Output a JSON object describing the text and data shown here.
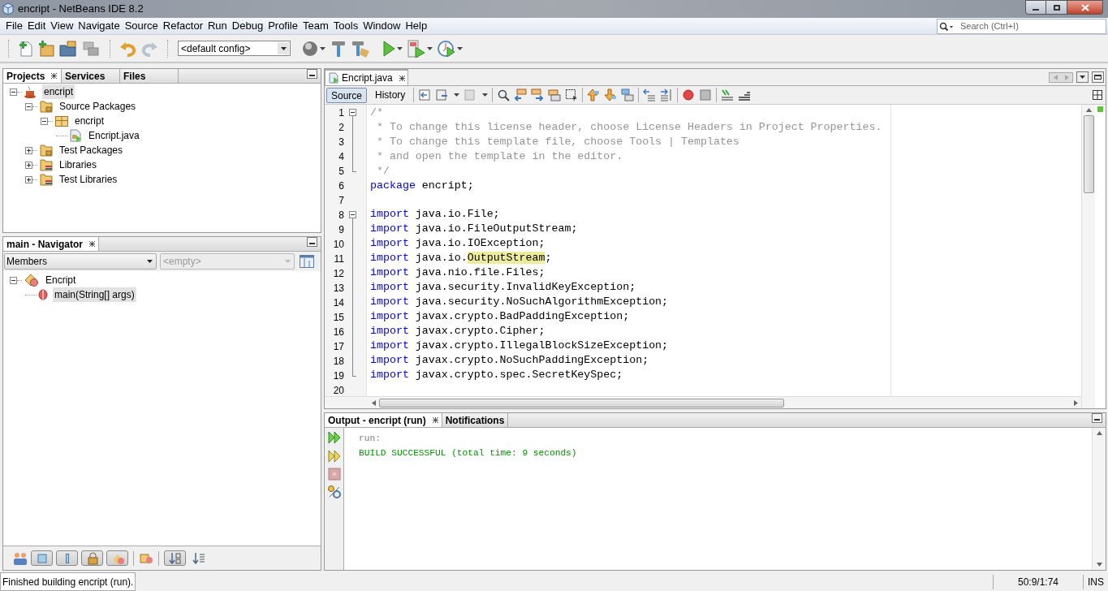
{
  "window": {
    "title": "encript - NetBeans IDE 8.2"
  },
  "menu": [
    "File",
    "Edit",
    "View",
    "Navigate",
    "Source",
    "Refactor",
    "Run",
    "Debug",
    "Profile",
    "Team",
    "Tools",
    "Window",
    "Help"
  ],
  "search": {
    "placeholder": "Search (Ctrl+I)"
  },
  "toolbar": {
    "config": "<default config>"
  },
  "projects_panel": {
    "tabs": [
      {
        "label": "Projects",
        "selected": true,
        "closable": true
      },
      {
        "label": "Services",
        "selected": false,
        "closable": false
      },
      {
        "label": "Files",
        "selected": false,
        "closable": false
      }
    ],
    "tree": [
      {
        "label": "encript",
        "kind": "project",
        "expanded": true,
        "selected": true,
        "children": [
          {
            "label": "Source Packages",
            "kind": "source-folder",
            "expanded": true,
            "selected": false,
            "children": [
              {
                "label": "encript",
                "kind": "package",
                "expanded": true,
                "selected": false,
                "children": [
                  {
                    "label": "Encript.java",
                    "kind": "java-file",
                    "selected": false
                  }
                ]
              }
            ]
          },
          {
            "label": "Test Packages",
            "kind": "source-folder",
            "expanded": false,
            "selected": false
          },
          {
            "label": "Libraries",
            "kind": "library",
            "expanded": false,
            "selected": false
          },
          {
            "label": "Test Libraries",
            "kind": "library",
            "expanded": false,
            "selected": false
          }
        ]
      }
    ]
  },
  "navigator": {
    "tabs": [
      {
        "label": "main - Navigator",
        "selected": true,
        "closable": true
      }
    ],
    "filter": "Members",
    "secondary": "<empty>",
    "tree": [
      {
        "label": "Encript",
        "kind": "class",
        "expanded": true,
        "selected": false,
        "children": [
          {
            "label": "main(String[] args)",
            "kind": "method",
            "selected": true
          }
        ]
      }
    ]
  },
  "editor": {
    "tabs": [
      {
        "label": "Encript.java",
        "selected": true,
        "closable": true
      }
    ],
    "views": [
      {
        "label": "Source",
        "selected": true
      },
      {
        "label": "History",
        "selected": false
      }
    ],
    "lines": [
      {
        "number": "1",
        "kind": "fold-start",
        "segments": [
          {
            "kind": "comment",
            "text": "/*"
          }
        ]
      },
      {
        "number": "2",
        "kind": "fold-body",
        "segments": [
          {
            "kind": "comment",
            "text": " * To change this license header, choose License Headers in Project Properties."
          }
        ]
      },
      {
        "number": "3",
        "kind": "fold-body",
        "segments": [
          {
            "kind": "comment",
            "text": " * To change this template file, choose Tools | Templates"
          }
        ]
      },
      {
        "number": "4",
        "kind": "fold-body",
        "segments": [
          {
            "kind": "comment",
            "text": " * and open the template in the editor."
          }
        ]
      },
      {
        "number": "5",
        "kind": "fold-end",
        "segments": [
          {
            "kind": "comment",
            "text": " */"
          }
        ]
      },
      {
        "number": "6",
        "kind": "plain",
        "segments": [
          {
            "kind": "keyword",
            "text": "package"
          },
          {
            "kind": "plain",
            "text": " encript;"
          }
        ]
      },
      {
        "number": "7",
        "kind": "plain"
      },
      {
        "number": "8",
        "kind": "fold-start",
        "segments": [
          {
            "kind": "keyword",
            "text": "import"
          },
          {
            "kind": "plain",
            "text": " java.io.File;"
          }
        ]
      },
      {
        "number": "9",
        "kind": "fold-body",
        "segments": [
          {
            "kind": "keyword",
            "text": "import"
          },
          {
            "kind": "plain",
            "text": " java.io.FileOutputStream;"
          }
        ]
      },
      {
        "number": "10",
        "kind": "fold-body",
        "segments": [
          {
            "kind": "keyword",
            "text": "import"
          },
          {
            "kind": "plain",
            "text": " java.io.IOException;"
          }
        ]
      },
      {
        "number": "11",
        "kind": "fold-body",
        "segments": [
          {
            "kind": "keyword",
            "text": "import"
          },
          {
            "kind": "plain",
            "text": " java.io."
          },
          {
            "kind": "highlight",
            "text": "OutputStream"
          },
          {
            "kind": "plain",
            "text": ";"
          }
        ]
      },
      {
        "number": "12",
        "kind": "fold-body",
        "segments": [
          {
            "kind": "keyword",
            "text": "import"
          },
          {
            "kind": "plain",
            "text": " java.nio.file.Files;"
          }
        ]
      },
      {
        "number": "13",
        "kind": "fold-body",
        "segments": [
          {
            "kind": "keyword",
            "text": "import"
          },
          {
            "kind": "plain",
            "text": " java.security.InvalidKeyException;"
          }
        ]
      },
      {
        "number": "14",
        "kind": "fold-body",
        "segments": [
          {
            "kind": "keyword",
            "text": "import"
          },
          {
            "kind": "plain",
            "text": " java.security.NoSuchAlgorithmException;"
          }
        ]
      },
      {
        "number": "15",
        "kind": "fold-body",
        "segments": [
          {
            "kind": "keyword",
            "text": "import"
          },
          {
            "kind": "plain",
            "text": " javax.crypto.BadPaddingException;"
          }
        ]
      },
      {
        "number": "16",
        "kind": "fold-body",
        "segments": [
          {
            "kind": "keyword",
            "text": "import"
          },
          {
            "kind": "plain",
            "text": " javax.crypto.Cipher;"
          }
        ]
      },
      {
        "number": "17",
        "kind": "fold-body",
        "segments": [
          {
            "kind": "keyword",
            "text": "import"
          },
          {
            "kind": "plain",
            "text": " javax.crypto.IllegalBlockSizeException;"
          }
        ]
      },
      {
        "number": "18",
        "kind": "fold-body",
        "segments": [
          {
            "kind": "keyword",
            "text": "import"
          },
          {
            "kind": "plain",
            "text": " javax.crypto.NoSuchPaddingException;"
          }
        ]
      },
      {
        "number": "19",
        "kind": "fold-end",
        "segments": [
          {
            "kind": "keyword",
            "text": "import"
          },
          {
            "kind": "plain",
            "text": " javax.crypto.spec.SecretKeySpec;"
          }
        ]
      },
      {
        "number": "20",
        "kind": "plain"
      }
    ]
  },
  "output": {
    "tabs": [
      {
        "label": "Output - encript (run)",
        "selected": true,
        "closable": true
      },
      {
        "label": "Notifications",
        "selected": false,
        "closable": false
      }
    ],
    "lines": [
      {
        "kind": "info",
        "text": "run:"
      },
      {
        "kind": "success",
        "text": "BUILD SUCCESSFUL (total time: 9 seconds)"
      }
    ]
  },
  "status_bar": {
    "message": "Finished building encript (run).",
    "position": "50:9/1:74",
    "mode": "INS"
  }
}
